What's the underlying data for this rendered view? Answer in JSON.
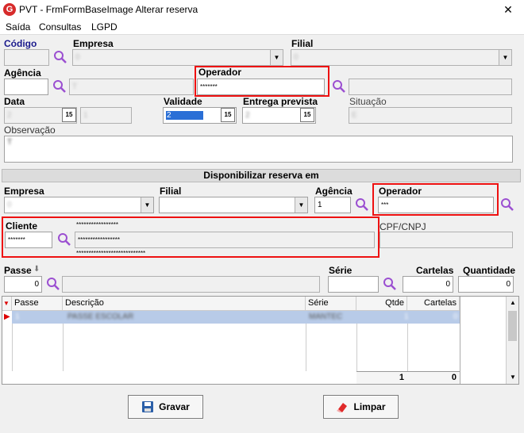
{
  "window": {
    "title": "PVT - FrmFormBaseImage Alterar reserva",
    "app_icon": "G",
    "close": "✕"
  },
  "menu": [
    "Saída",
    "Consultas",
    "LGPD"
  ],
  "top": {
    "codigo_label": "Código",
    "empresa_label": "Empresa",
    "empresa_value": "0",
    "filial_label": "Filial",
    "filial_value": "0",
    "agencia_label": "Agência",
    "agencia_desc": "T",
    "operador_label": "Operador",
    "operador_value": "*******",
    "data_label": "Data",
    "data_value": "2",
    "hora_value": "1",
    "validade_label": "Validade",
    "validade_value": "2",
    "entrega_label": "Entrega prevista",
    "entrega_value": "2",
    "situacao_label": "Situação",
    "situacao_value": "E",
    "observacao_label": "Observação",
    "observacao_value": "T"
  },
  "section_title": "Disponibilizar reserva em",
  "bottom": {
    "empresa_label": "Empresa",
    "empresa_value": "0",
    "filial_label": "Filial",
    "agencia_label": "Agência",
    "agencia_value": "1",
    "operador_label": "Operador",
    "operador_value": "***",
    "cliente_label": "Cliente",
    "cliente_value": "*******",
    "cliente_name_top": "*****************",
    "cliente_name_mid": "*****************",
    "cliente_name_bot": "****************************",
    "cpf_label": "CPF/CNPJ",
    "passe_label": "Passe",
    "passe_value": "0",
    "serie_label": "Série",
    "cartelas_label": "Cartelas",
    "cartelas_value": "0",
    "quantidade_label": "Quantidade",
    "quantidade_value": "0"
  },
  "grid": {
    "columns": [
      "Passe",
      "Descrição",
      "Série",
      "Qtde",
      "Cartelas"
    ],
    "rows": [
      {
        "passe": "1",
        "descricao": "PASSE ESCOLAR",
        "serie": "MANTEC",
        "qtde": "1",
        "cartelas": "0"
      }
    ],
    "total_qtde": "1",
    "total_cartelas": "0"
  },
  "buttons": {
    "gravar": "Gravar",
    "limpar": "Limpar"
  },
  "colors": {
    "highlight_red": "#e11111",
    "selection_blue": "#2a6fd6",
    "search_icon": "#9b4fd1"
  }
}
